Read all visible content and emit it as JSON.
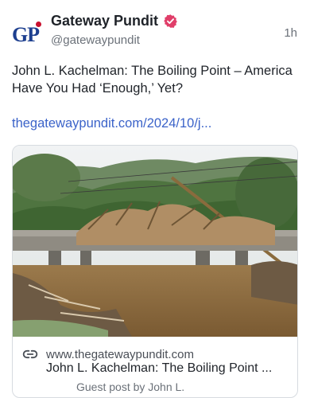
{
  "post": {
    "display_name": "Gateway Pundit",
    "handle": "@gatewaypundit",
    "time": "1h",
    "avatar_text": "GP",
    "text": "John L. Kachelman: The Boiling Point – America Have You Had ‘Enough,’ Yet?",
    "link": "thegatewaypundit.com/2024/10/j..."
  },
  "card": {
    "domain": "www.thegatewaypundit.com",
    "title": "John L. Kachelman: The Boiling Point ...",
    "description": "Guest post by John L."
  },
  "colors": {
    "link": "#3b63c9",
    "verified": "#e03e69",
    "brand_blue": "#1d3f8f",
    "brand_red": "#c8102e"
  },
  "icons": {
    "verified": "verified-badge-icon",
    "link": "link-icon"
  }
}
